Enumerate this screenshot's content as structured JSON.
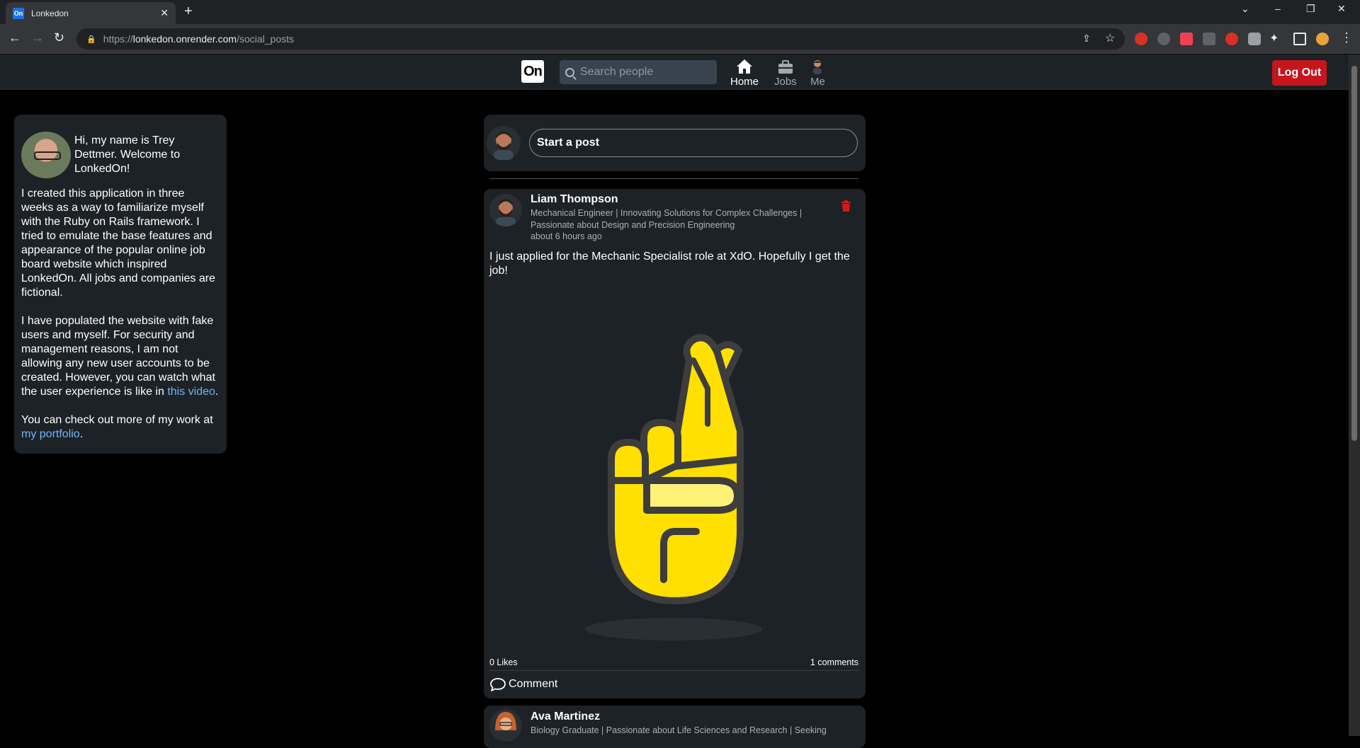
{
  "browser": {
    "tab_title": "Lonkedon",
    "tab_favicon_text": "On",
    "url_scheme": "https://",
    "url_host": "lonkedon.onrender.com",
    "url_path": "/social_posts"
  },
  "nav": {
    "logo": "On",
    "search_placeholder": "Search people",
    "home_label": "Home",
    "jobs_label": "Jobs",
    "me_label": "Me",
    "logout_label": "Log Out"
  },
  "info": {
    "greeting": "Hi, my name is Trey Dettmer. Welcome to LonkedOn!",
    "para1": "I created this application in three weeks as a way to familiarize myself with the Ruby on Rails framework. I tried to emulate the base features and appearance of the popular online job board website which inspired LonkedOn. All jobs and companies are fictional.",
    "para2_start": "I have populated the website with fake users and myself. For security and management reasons, I am not allowing any new user accounts to be created. However, you can watch what the user experience is like in ",
    "para2_link": "this video",
    "para2_end": ".",
    "para3_start": "You can check out more of my work at ",
    "para3_link": "my portfolio",
    "para3_end": "."
  },
  "composer": {
    "placeholder": "Start a post"
  },
  "posts": [
    {
      "author": "Liam Thompson",
      "headline": "Mechanical Engineer | Innovating Solutions for Complex Challenges | Passionate about Design and Precision Engineering",
      "time": "about 6 hours ago",
      "text": "I just applied for the Mechanic Specialist role at XdO. Hopefully I get the job!",
      "likes": "0 Likes",
      "comments": "1 comments",
      "comment_label": "Comment"
    },
    {
      "author": "Ava Martinez",
      "headline": "Biology Graduate | Passionate about Life Sciences and Research | Seeking"
    }
  ],
  "colors": {
    "accent_red": "#c4161c",
    "link_blue": "#70b5f9",
    "card_bg": "#1d2226"
  }
}
